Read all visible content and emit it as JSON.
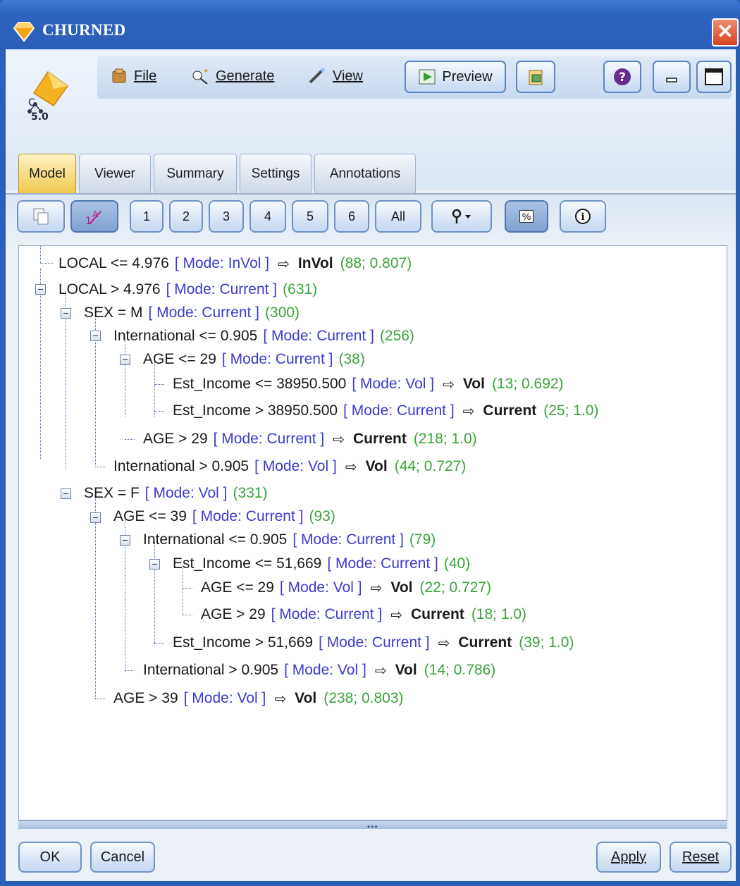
{
  "window": {
    "title": "CHURNED"
  },
  "node_icon_label": "5.0",
  "menu": {
    "file": "File",
    "generate": "Generate",
    "view": "View",
    "preview": "Preview"
  },
  "tabs": [
    "Model",
    "Viewer",
    "Summary",
    "Settings",
    "Annotations"
  ],
  "active_tab": "Model",
  "toolbar": {
    "levels": [
      "1",
      "2",
      "3",
      "4",
      "5",
      "6",
      "All"
    ],
    "percent": "%",
    "info": "i"
  },
  "tree": [
    {
      "cond": "LOCAL <= 4.976",
      "mode": "[ Mode: InVol ]",
      "pred": "InVol",
      "count": "(88; 0.807)"
    },
    {
      "cond": "LOCAL > 4.976",
      "mode": "[ Mode: Current ]",
      "count": "(631)"
    },
    {
      "cond": "SEX = M",
      "mode": "[ Mode: Current ]",
      "count": "(300)"
    },
    {
      "cond": "International <= 0.905",
      "mode": "[ Mode: Current ]",
      "count": "(256)"
    },
    {
      "cond": "AGE <= 29",
      "mode": "[ Mode: Current ]",
      "count": "(38)"
    },
    {
      "cond": "Est_Income <= 38950.500",
      "mode": "[ Mode: Vol ]",
      "pred": "Vol",
      "count": "(13; 0.692)"
    },
    {
      "cond": "Est_Income > 38950.500",
      "mode": "[ Mode: Current ]",
      "pred": "Current",
      "count": "(25; 1.0)"
    },
    {
      "cond": "AGE > 29",
      "mode": "[ Mode: Current ]",
      "pred": "Current",
      "count": "(218; 1.0)"
    },
    {
      "cond": "International > 0.905",
      "mode": "[ Mode: Vol ]",
      "pred": "Vol",
      "count": "(44; 0.727)"
    },
    {
      "cond": "SEX = F",
      "mode": "[ Mode: Vol ]",
      "count": "(331)"
    },
    {
      "cond": "AGE <= 39",
      "mode": "[ Mode: Current ]",
      "count": "(93)"
    },
    {
      "cond": "International <= 0.905",
      "mode": "[ Mode: Current ]",
      "count": "(79)"
    },
    {
      "cond": "Est_Income <= 51,669",
      "mode": "[ Mode: Current ]",
      "count": "(40)"
    },
    {
      "cond": "AGE <= 29",
      "mode": "[ Mode: Vol ]",
      "pred": "Vol",
      "count": "(22; 0.727)"
    },
    {
      "cond": "AGE > 29",
      "mode": "[ Mode: Current ]",
      "pred": "Current",
      "count": "(18; 1.0)"
    },
    {
      "cond": "Est_Income > 51,669",
      "mode": "[ Mode: Current ]",
      "pred": "Current",
      "count": "(39; 1.0)"
    },
    {
      "cond": "International > 0.905",
      "mode": "[ Mode: Vol ]",
      "pred": "Vol",
      "count": "(14; 0.786)"
    },
    {
      "cond": "AGE > 39",
      "mode": "[ Mode: Vol ]",
      "pred": "Vol",
      "count": "(238; 0.803)"
    }
  ],
  "footer": {
    "ok": "OK",
    "cancel": "Cancel",
    "apply": "Apply",
    "reset": "Reset"
  },
  "colors": {
    "titlebar": "#2b5fb8",
    "mode_text": "#3b3bd0",
    "count_text": "#3aa33a",
    "active_tab": "#f1c74e"
  }
}
